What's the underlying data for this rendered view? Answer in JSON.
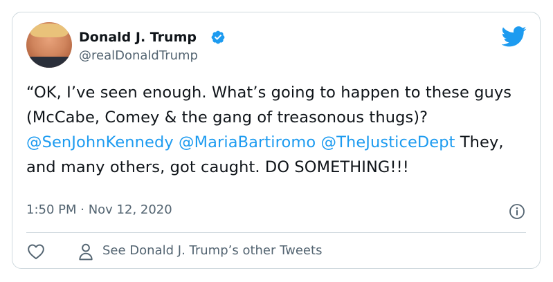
{
  "author": {
    "name": "Donald J. Trump",
    "handle": "@realDonaldTrump",
    "verified": true
  },
  "tweet": {
    "text_part1": "“OK, I’ve seen enough. What’s going to happen to these guys (McCabe, Comey & the gang of treasonous thugs)? ",
    "mention1": "@SenJohnKennedy",
    "space1": " ",
    "mention2": "@MariaBartiromo",
    "space2": " ",
    "mention3": "@TheJusticeDept",
    "text_part2": " They, and many others, got caught. DO SOMETHING!!!",
    "timestamp": "1:50 PM · Nov 12, 2020"
  },
  "footer": {
    "other_tweets_label": "See Donald J. Trump’s other Tweets"
  },
  "icons": {
    "brand": "twitter-bird-icon",
    "verified": "verified-badge-icon",
    "info": "info-icon",
    "like": "heart-icon",
    "profile": "person-icon"
  },
  "colors": {
    "accent": "#1d9bf0",
    "text": "#0f1419",
    "secondary": "#536471",
    "border": "#cfd9de"
  }
}
